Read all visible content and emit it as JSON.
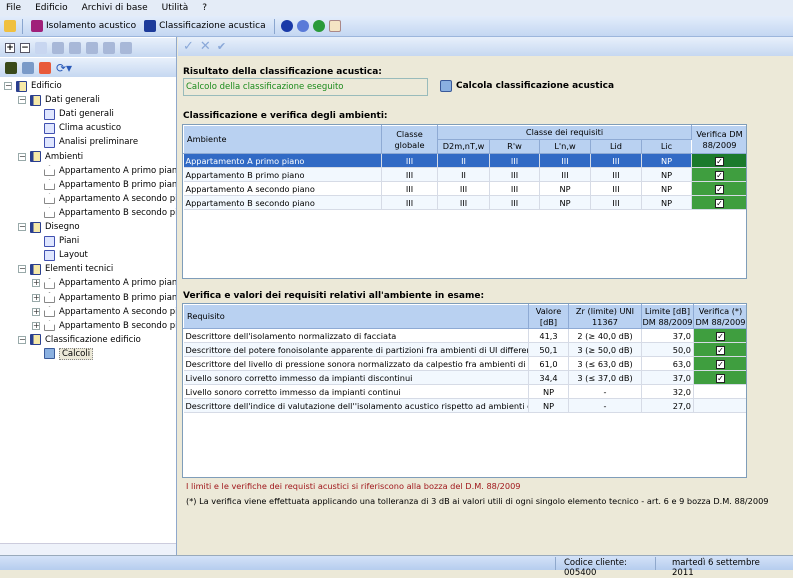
{
  "menu": [
    "File",
    "Edificio",
    "Archivi di base",
    "Utilità",
    "?"
  ],
  "toolbar": {
    "isolamento": "Isolamento acustico",
    "classificazione": "Classificazione acustica"
  },
  "tree": [
    {
      "label": "Edificio",
      "level": 0,
      "icon": "book",
      "toggle": "-"
    },
    {
      "label": "Dati generali",
      "level": 1,
      "icon": "book",
      "toggle": "-"
    },
    {
      "label": "Dati generali",
      "level": 2,
      "icon": "doc"
    },
    {
      "label": "Clima acustico",
      "level": 2,
      "icon": "doc"
    },
    {
      "label": "Analisi preliminare",
      "level": 2,
      "icon": "doc"
    },
    {
      "label": "Ambienti",
      "level": 1,
      "icon": "book",
      "toggle": "-"
    },
    {
      "label": "Appartamento A primo piano",
      "level": 2,
      "icon": "house"
    },
    {
      "label": "Appartamento B primo piano",
      "level": 2,
      "icon": "house"
    },
    {
      "label": "Appartamento A secondo piano",
      "level": 2,
      "icon": "house"
    },
    {
      "label": "Appartamento B secondo piano",
      "level": 2,
      "icon": "house"
    },
    {
      "label": "Disegno",
      "level": 1,
      "icon": "book",
      "toggle": "-"
    },
    {
      "label": "Piani",
      "level": 2,
      "icon": "doc"
    },
    {
      "label": "Layout",
      "level": 2,
      "icon": "doc"
    },
    {
      "label": "Elementi tecnici",
      "level": 1,
      "icon": "book",
      "toggle": "-"
    },
    {
      "label": "Appartamento A primo piano",
      "level": 2,
      "icon": "house",
      "toggle": "+"
    },
    {
      "label": "Appartamento B primo piano",
      "level": 2,
      "icon": "house",
      "toggle": "+"
    },
    {
      "label": "Appartamento A secondo piano",
      "level": 2,
      "icon": "house",
      "toggle": "+"
    },
    {
      "label": "Appartamento B secondo piano",
      "level": 2,
      "icon": "house",
      "toggle": "+"
    },
    {
      "label": "Classificazione edificio",
      "level": 1,
      "icon": "book",
      "toggle": "-"
    },
    {
      "label": "Calcoli",
      "level": 2,
      "icon": "calc",
      "selected": true
    }
  ],
  "result": {
    "title": "Risultato della classificazione acustica:",
    "value": "Calcolo della classificazione eseguito",
    "button": "Calcola classificazione acustica"
  },
  "table1": {
    "title": "Classificazione e verifica degli ambienti:",
    "headers": {
      "ambiente": "Ambiente",
      "classe": "Classe globale",
      "group": "Classe dei requisiti",
      "cols": [
        "D2m,nT,w",
        "R'w",
        "L'n,w",
        "Lid",
        "Lic"
      ],
      "verifica": "Verifica DM 88/2009"
    },
    "rows": [
      {
        "ambiente": "Appartamento A primo piano",
        "classe": "III",
        "vals": [
          "II",
          "III",
          "III",
          "III",
          "NP"
        ],
        "ok": true,
        "selected": true
      },
      {
        "ambiente": "Appartamento B primo piano",
        "classe": "III",
        "vals": [
          "II",
          "III",
          "III",
          "III",
          "NP"
        ],
        "ok": true
      },
      {
        "ambiente": "Appartamento A secondo piano",
        "classe": "III",
        "vals": [
          "III",
          "III",
          "NP",
          "III",
          "NP"
        ],
        "ok": true
      },
      {
        "ambiente": "Appartamento B secondo piano",
        "classe": "III",
        "vals": [
          "III",
          "III",
          "NP",
          "III",
          "NP"
        ],
        "ok": true
      }
    ]
  },
  "table2": {
    "title": "Verifica e valori dei requisiti relativi all'ambiente in esame:",
    "headers": [
      "Requisito",
      "Valore [dB]",
      "Zr (limite) UNI 11367",
      "Limite [dB] DM 88/2009",
      "Verifica (*) DM 88/2009"
    ],
    "rows": [
      {
        "req": "Descrittore dell'isolamento normalizzato di facciata",
        "val": "41,3",
        "zr": "2 (≥ 40,0 dB)",
        "lim": "37,0",
        "ok": true
      },
      {
        "req": "Descrittore del potere fonoisolante apparente di partizioni fra ambienti di UI differenti",
        "val": "50,1",
        "zr": "3 (≥ 50,0 dB)",
        "lim": "50,0",
        "ok": true
      },
      {
        "req": "Descrittore del livello di pressione sonora normalizzato da calpestio fra ambienti di UI differe",
        "val": "61,0",
        "zr": "3 (≤ 63,0 dB)",
        "lim": "63,0",
        "ok": true
      },
      {
        "req": "Livello sonoro corretto immesso da impianti discontinui",
        "val": "34,4",
        "zr": "3 (≤ 37,0 dB)",
        "lim": "37,0",
        "ok": true
      },
      {
        "req": "Livello sonoro corretto immesso da impianti continui",
        "val": "NP",
        "zr": "-",
        "lim": "32,0",
        "ok": false
      },
      {
        "req": "Descrittore dell'indice di valutazione dell''isolamento acustico rispetto ad ambienti di uso con",
        "val": "NP",
        "zr": "-",
        "lim": "27,0",
        "ok": false
      }
    ]
  },
  "notes": [
    "I limiti e le verifiche dei requisti acustici si riferiscono alla bozza del D.M. 88/2009",
    "(*) La verifica viene effettuata applicando una tolleranza di 3 dB ai valori utili di ogni singolo elemento tecnico - art. 6 e 9 bozza D.M. 88/2009"
  ],
  "status": {
    "codice": "Codice cliente: 005400",
    "data": "martedì 6 settembre 2011"
  },
  "colors": {
    "selected": "#316ac5",
    "ok": "#3f9e3f",
    "header": "#b9d1f1"
  }
}
